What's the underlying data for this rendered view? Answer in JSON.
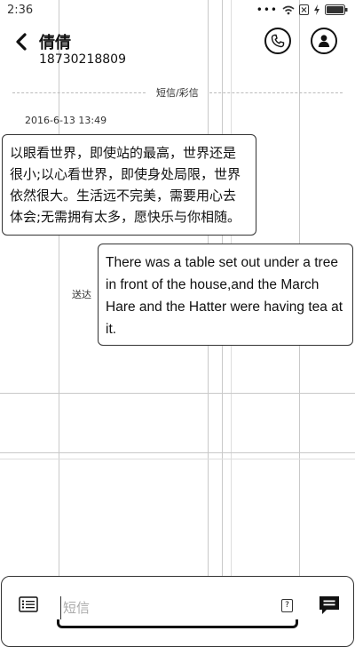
{
  "status_bar": {
    "time": "2:36",
    "icons": [
      "more-dots-icon",
      "wifi-icon",
      "sim-x-icon",
      "charging-icon",
      "battery-icon"
    ]
  },
  "header": {
    "contact_name": "倩倩",
    "phone_number": "18730218809",
    "icons": [
      "back-icon",
      "phone-icon",
      "contact-profile-icon"
    ]
  },
  "thread": {
    "message_type_label": "短信/彩信",
    "timestamp": "2016-6-13 13:49",
    "messages": [
      {
        "direction": "incoming",
        "text": "以眼看世界，即使站的最高，世界还是很小;以心看世界，即使身处局限，世界依然很大。生活远不完美，需要用心去体会;无需拥有太多，愿快乐与你相随。"
      },
      {
        "direction": "outgoing",
        "text": "There was a table set out under a tree in front of the house,and the March Hare and the Hatter were having tea at it.",
        "status": "送达"
      }
    ]
  },
  "composer": {
    "placeholder": "短信",
    "value": "",
    "sim_label": "?",
    "icons": [
      "template-list-icon",
      "send-icon"
    ]
  }
}
